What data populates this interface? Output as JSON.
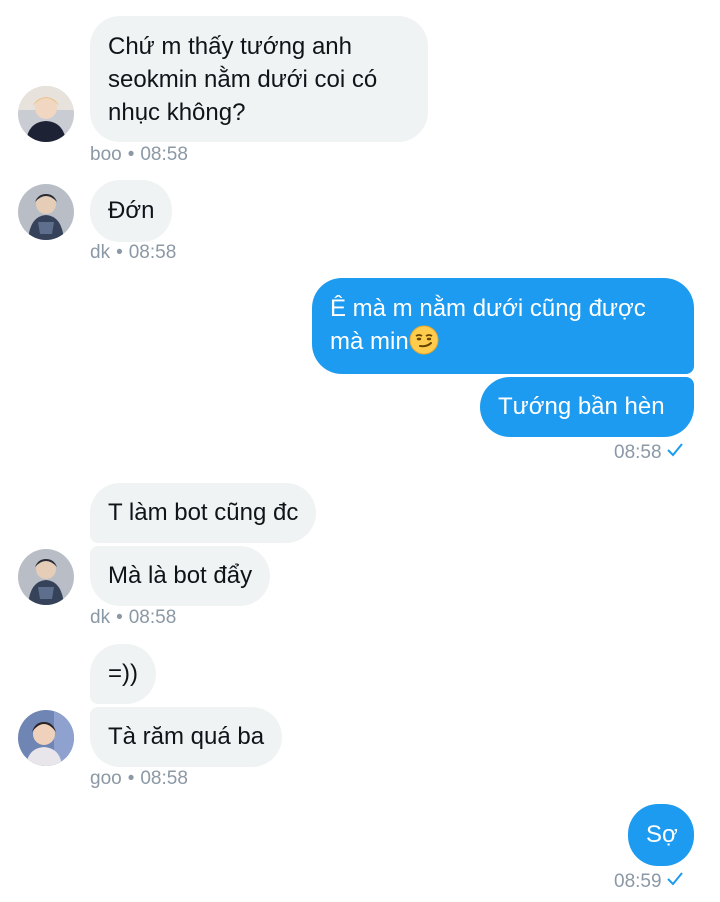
{
  "messages": [
    {
      "text": "Chứ m thấy tướng anh\nseokmin nằm dưới coi có\nnhục không?"
    },
    {
      "text": "Đớn"
    },
    {
      "text": "Ê mà m nằm dưới cũng được\nmà min",
      "emoji": "smirking-face"
    },
    {
      "text": "Tướng bần hèn"
    },
    {
      "text": "T làm bot cũng đc"
    },
    {
      "text": "Mà là bot đẩy"
    },
    {
      "text": "=))"
    },
    {
      "text": "Tà răm quá ba"
    },
    {
      "text": "Sợ"
    }
  ],
  "meta": [
    {
      "user": "boo",
      "sep": "•",
      "time": "08:58"
    },
    {
      "user": "dk",
      "sep": "•",
      "time": "08:58"
    },
    {
      "time": "08:58",
      "status_icon": "sent-check-icon"
    },
    {
      "user": "dk",
      "sep": "•",
      "time": "08:58"
    },
    {
      "user": "goo",
      "sep": "•",
      "time": "08:58"
    },
    {
      "time": "08:59",
      "status_icon": "sent-check-icon"
    }
  ],
  "colors": {
    "outgoing_bubble": "#1d9bf0",
    "incoming_bubble": "#eff3f4",
    "meta_text": "#8b98a5"
  }
}
